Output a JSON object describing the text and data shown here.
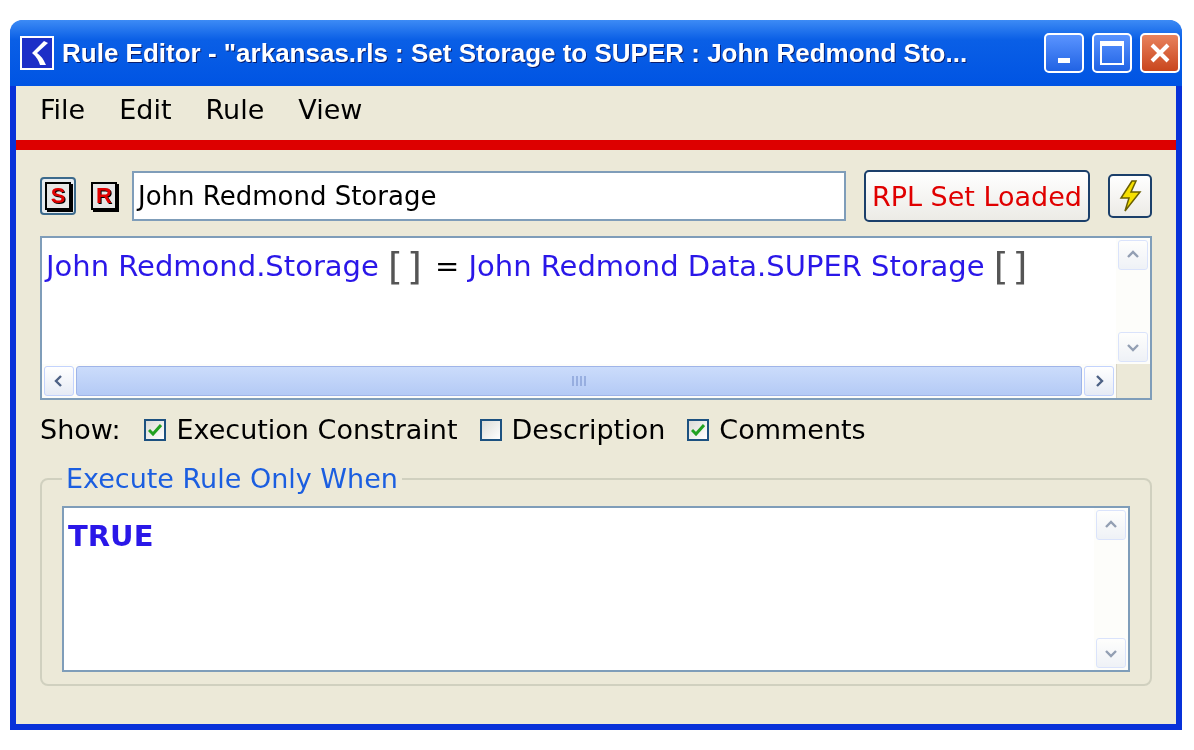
{
  "window": {
    "title": "Rule Editor - \"arkansas.rls : Set Storage to SUPER : John Redmond Sto..."
  },
  "menu": [
    "File",
    "Edit",
    "Rule",
    "View"
  ],
  "toolbar": {
    "mode_buttons": [
      {
        "text": "S",
        "pressed": true
      },
      {
        "text": "R",
        "pressed": false
      }
    ],
    "rule_name": "John Redmond Storage",
    "status_button": "RPL Set Loaded"
  },
  "expression": [
    {
      "kind": "ref",
      "text": "John Redmond.Storage"
    },
    {
      "kind": "bracket",
      "text": "[]"
    },
    {
      "kind": "op",
      "text": "="
    },
    {
      "kind": "ref",
      "text": "John Redmond Data.SUPER Storage"
    },
    {
      "kind": "bracket",
      "text": "[]"
    }
  ],
  "show": {
    "label": "Show:",
    "options": [
      {
        "label": "Execution Constraint",
        "checked": true
      },
      {
        "label": "Description",
        "checked": false
      },
      {
        "label": "Comments",
        "checked": true
      }
    ]
  },
  "constraint": {
    "label": "Execute Rule Only When",
    "expression": [
      {
        "kind": "keyword",
        "text": "TRUE"
      }
    ]
  }
}
